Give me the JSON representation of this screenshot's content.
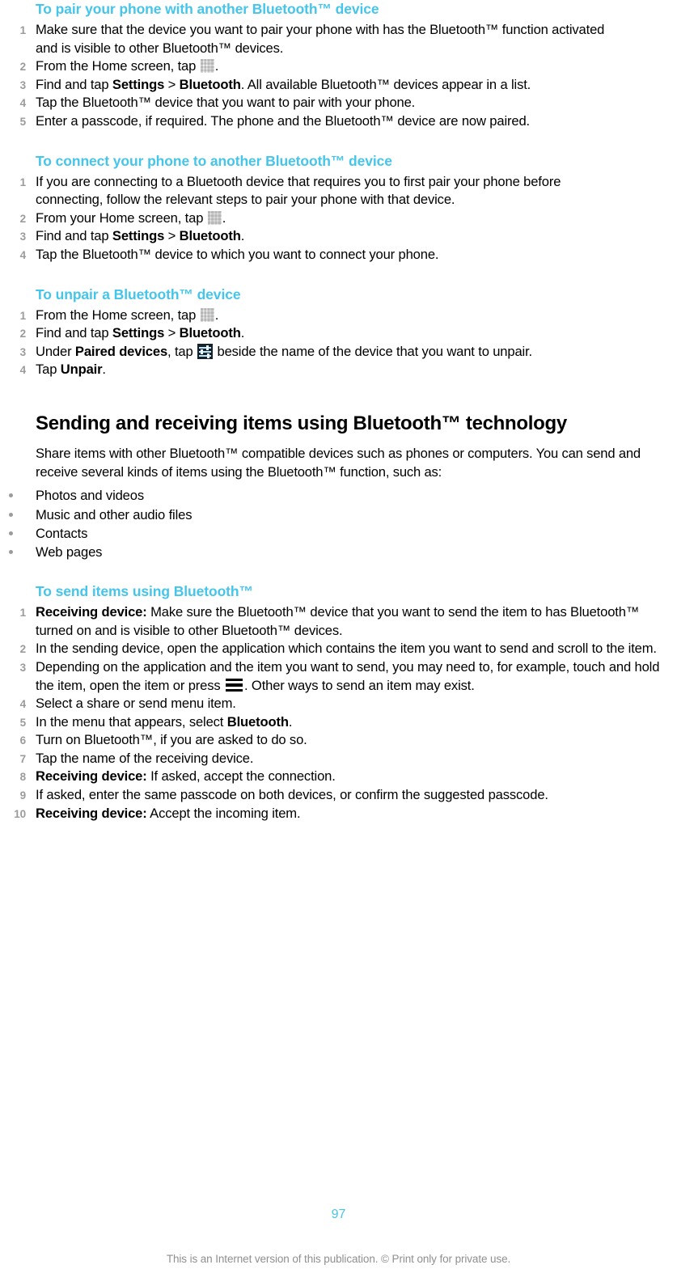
{
  "document": {
    "page_number": "97",
    "footer_note": "This is an Internet version of this publication. © Print only for private use.",
    "accent_color": "#45c5ea",
    "muted_color": "#9b9b9b"
  },
  "sections": [
    {
      "heading": "To pair your phone with another Bluetooth™ device",
      "steps": [
        {
          "num": "1",
          "text": "Make sure that the device you want to pair your phone with has the Bluetooth™ function activated and is visible to other Bluetooth™ devices."
        },
        {
          "num": "2",
          "text_pre": "From the Home screen, tap ",
          "icon": "app-drawer-icon",
          "text_post": "."
        },
        {
          "num": "3",
          "text_pre": "Find and tap ",
          "bold1": "Settings",
          "mid": " > ",
          "bold2": "Bluetooth",
          "text_post": ". All available Bluetooth™ devices appear in a list."
        },
        {
          "num": "4",
          "text": "Tap the Bluetooth™ device that you want to pair with your phone."
        },
        {
          "num": "5",
          "text": "Enter a passcode, if required. The phone and the Bluetooth™ device are now paired."
        }
      ]
    },
    {
      "heading": "To connect your phone to another Bluetooth™ device",
      "steps": [
        {
          "num": "1",
          "text": "If you are connecting to a Bluetooth device that requires you to first pair your phone before connecting, follow the relevant steps to pair your phone with that device."
        },
        {
          "num": "2",
          "text_pre": "From your Home screen, tap ",
          "icon": "app-drawer-icon",
          "text_post": "."
        },
        {
          "num": "3",
          "text_pre": "Find and tap ",
          "bold1": "Settings",
          "mid": " > ",
          "bold2": "Bluetooth",
          "text_post": "."
        },
        {
          "num": "4",
          "text": "Tap the Bluetooth™ device to which you want to connect your phone."
        }
      ]
    },
    {
      "heading": "To unpair a Bluetooth™ device",
      "steps": [
        {
          "num": "1",
          "text_pre": "From the Home screen, tap ",
          "icon": "app-drawer-icon",
          "text_post": "."
        },
        {
          "num": "2",
          "text_pre": "Find and tap ",
          "bold1": "Settings",
          "mid": " > ",
          "bold2": "Bluetooth",
          "text_post": "."
        },
        {
          "num": "3",
          "text_pre": "Under ",
          "bold1": "Paired devices",
          "mid": ", tap ",
          "icon": "settings-sliders-icon",
          "text_post": " beside the name of the device that you want to unpair."
        },
        {
          "num": "4",
          "text_pre": "Tap ",
          "bold1": "Unpair",
          "text_post": "."
        }
      ]
    }
  ],
  "main_section": {
    "heading": "Sending and receiving items using Bluetooth™ technology",
    "paragraph": "Share items with other Bluetooth™ compatible devices such as phones or computers. You can send and receive several kinds of items using the Bluetooth™ function, such as:",
    "bullets": [
      "Photos and videos",
      "Music and other audio files",
      "Contacts",
      "Web pages"
    ],
    "subsection": {
      "heading": "To send items using Bluetooth™",
      "steps": [
        {
          "num": "1",
          "lead": "Receiving device:",
          "text": " Make sure the Bluetooth™ device that you want to send the item to has Bluetooth™ turned on and is visible to other Bluetooth™ devices."
        },
        {
          "num": "2",
          "text": "In the sending device, open the application which contains the item you want to send and scroll to the item."
        },
        {
          "num": "3",
          "text_pre": "Depending on the application and the item you want to send, you may need to, for example, touch and hold the item, open the item or press ",
          "icon": "menu-icon",
          "text_post": ". Other ways to send an item may exist."
        },
        {
          "num": "4",
          "text": "Select a share or send menu item."
        },
        {
          "num": "5",
          "text_pre": "In the menu that appears, select ",
          "bold1": "Bluetooth",
          "text_post": "."
        },
        {
          "num": "6",
          "text": "Turn on Bluetooth™, if you are asked to do so."
        },
        {
          "num": "7",
          "text": "Tap the name of the receiving device."
        },
        {
          "num": "8",
          "lead": "Receiving device:",
          "text": " If asked, accept the connection."
        },
        {
          "num": "9",
          "text": "If asked, enter the same passcode on both devices, or confirm the suggested passcode."
        },
        {
          "num": "10",
          "lead": "Receiving device:",
          "text": " Accept the incoming item."
        }
      ]
    }
  }
}
